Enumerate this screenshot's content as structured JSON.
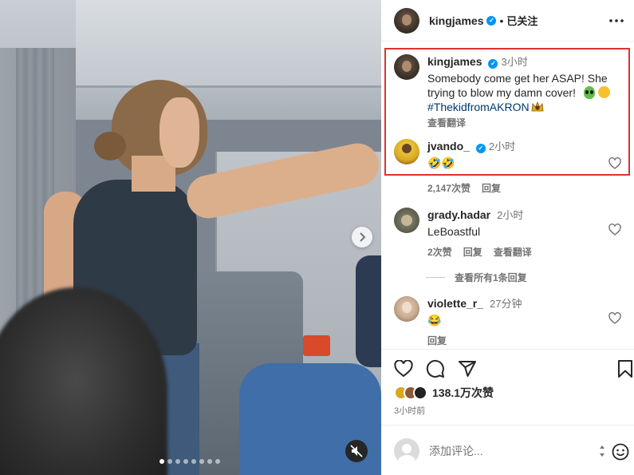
{
  "post": {
    "username": "kingjames",
    "follow_status": "已关注",
    "separator": "•",
    "caption": {
      "username": "kingjames",
      "time": "3小时",
      "text": "Somebody come get her ASAP! She trying to blow my damn cover!",
      "hashtag": "#ThekidfromAKRON",
      "translate": "查看翻译"
    },
    "likes": "138.1万次赞",
    "posted_ago": "3小时前"
  },
  "comments": [
    {
      "username": "jvando_",
      "verified": true,
      "time": "2小时",
      "text": "🤣🤣",
      "likes": "2,147次赞",
      "reply": "回复"
    },
    {
      "username": "grady.hadar",
      "verified": false,
      "time": "2小时",
      "text": "LeBoastful",
      "likes": "2次赞",
      "reply": "回复",
      "translate": "查看翻译",
      "view_replies": "查看所有1条回复"
    },
    {
      "username": "violette_r_",
      "verified": false,
      "time": "27分钟",
      "text": "😂",
      "reply": "回复"
    }
  ],
  "composer": {
    "placeholder": "添加评论..."
  },
  "carousel": {
    "slides": 8,
    "active": 0
  },
  "icons": {
    "more": "more-horizontal-icon",
    "like": "heart-icon",
    "comment": "comment-bubble-icon",
    "share": "send-icon",
    "save": "bookmark-icon",
    "emoji": "smiley-icon",
    "mute": "muted-speaker-icon",
    "next": "chevron-right-icon"
  },
  "colors": {
    "verified": "#0095f6",
    "highlight_border": "#e03030",
    "hashtag": "#00376b"
  }
}
